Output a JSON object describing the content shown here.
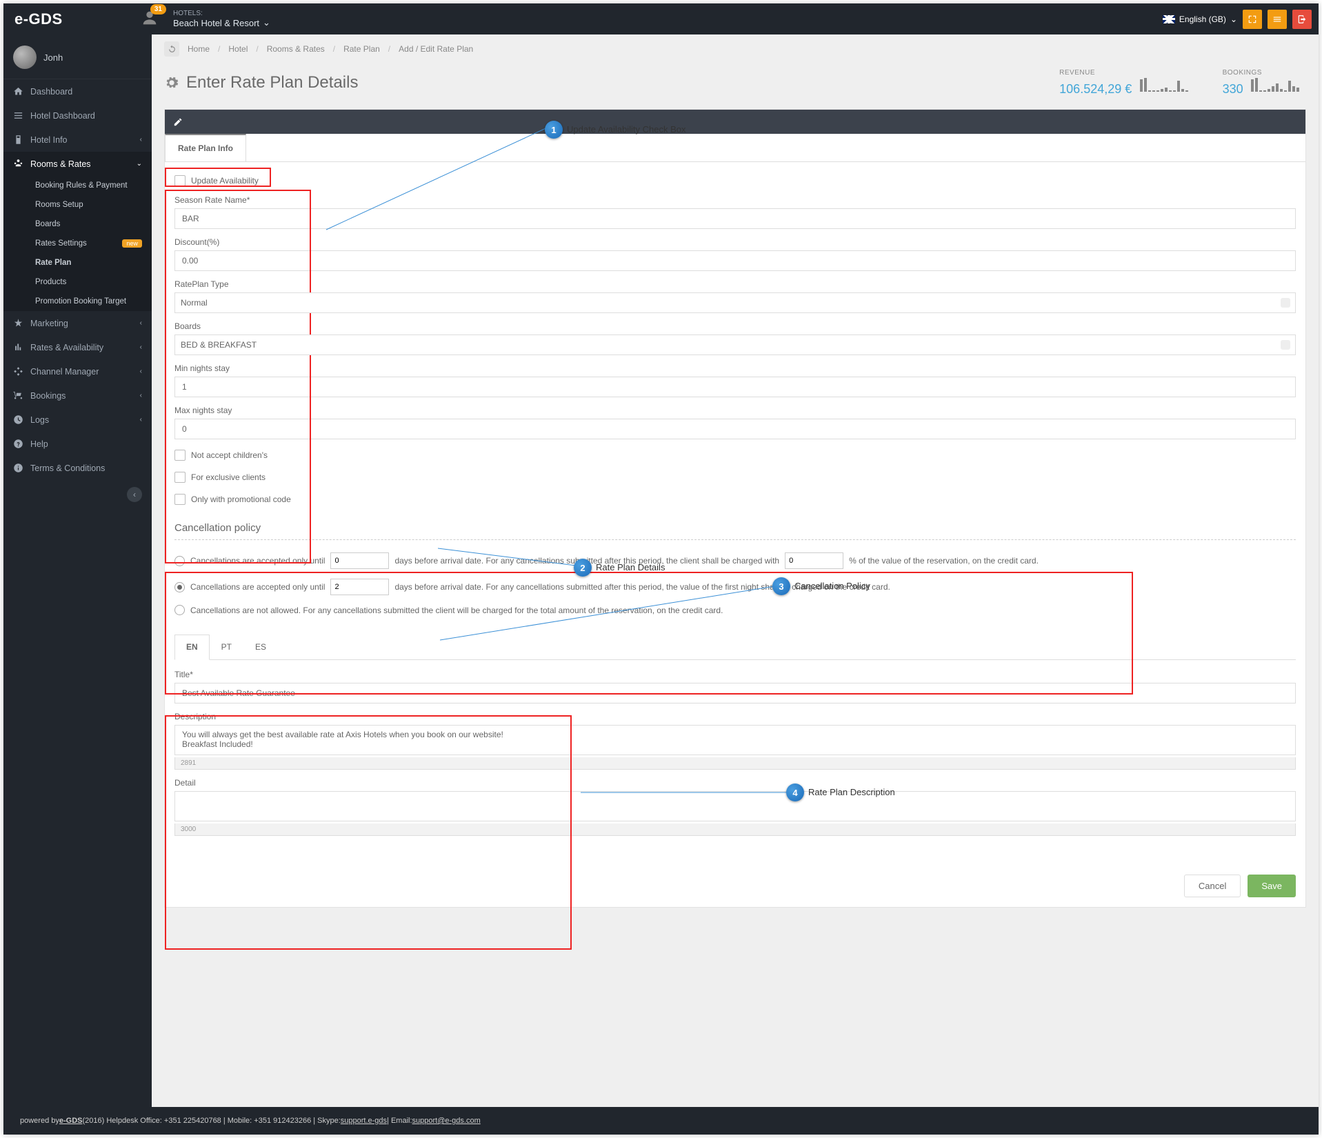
{
  "brand": "e-GDS",
  "top": {
    "badge_count": "31",
    "hotels_label": "HOTELS:",
    "hotel_name": "Beach Hotel & Resort",
    "lang": "English (GB)"
  },
  "user": "Jonh",
  "menu": {
    "dashboard": "Dashboard",
    "hotel_dashboard": "Hotel Dashboard",
    "hotel_info": "Hotel Info",
    "rooms_rates": "Rooms & Rates",
    "sub": {
      "booking_rules": "Booking Rules & Payment",
      "rooms_setup": "Rooms Setup",
      "boards": "Boards",
      "rates_settings": "Rates Settings",
      "new_badge": "new",
      "rate_plan": "Rate Plan",
      "products": "Products",
      "promotion": "Promotion Booking Target"
    },
    "marketing": "Marketing",
    "rates_avail": "Rates & Availability",
    "channel_manager": "Channel Manager",
    "bookings": "Bookings",
    "logs": "Logs",
    "help": "Help",
    "terms": "Terms & Conditions"
  },
  "crumbs": [
    "Home",
    "Hotel",
    "Rooms & Rates",
    "Rate Plan",
    "Add / Edit Rate Plan"
  ],
  "page_title": "Enter Rate Plan Details",
  "stats": {
    "rev_label": "REVENUE",
    "rev_value": "106.524,29 €",
    "book_label": "BOOKINGS",
    "book_value": "330"
  },
  "tab_info": "Rate Plan Info",
  "form": {
    "update_avail": "Update Availability",
    "season_label": "Season Rate Name*",
    "season_value": "BAR",
    "discount_label": "Discount(%)",
    "discount_value": "0.00",
    "type_label": "RatePlan Type",
    "type_value": "Normal",
    "boards_label": "Boards",
    "boards_value": "BED & BREAKFAST",
    "min_label": "Min nights stay",
    "min_value": "1",
    "max_label": "Max nights stay",
    "max_value": "0",
    "no_children": "Not accept children's",
    "exclusive": "For exclusive clients",
    "promo_only": "Only with promotional code"
  },
  "cancel": {
    "header": "Cancellation policy",
    "r1a": "Cancellations are accepted only until",
    "r1b": "days before arrival date. For any cancellations submitted after this period, the client shall be charged with",
    "r1c": "% of the value of the reservation, on the credit card.",
    "r1_days": "0",
    "r1_pct": "0",
    "r2a": "Cancellations are accepted only until",
    "r2b": "days before arrival date. For any cancellations submitted after this period, the value of the first night shall be charged on the credit card.",
    "r2_days": "2",
    "r3": "Cancellations are not allowed. For any cancellations submitted the client will be charged for the total amount of the reservation, on the credit card."
  },
  "lang_tabs": {
    "en": "EN",
    "pt": "PT",
    "es": "ES"
  },
  "desc": {
    "title_label": "Title*",
    "title_value": "Best Available Rate Guarantee",
    "desc_label": "Description",
    "desc_value": "You will always get the best available rate at Axis Hotels when you book on our website!\nBreakfast Included!",
    "desc_count": "2891",
    "detail_label": "Detail",
    "detail_value": "",
    "detail_count": "3000"
  },
  "buttons": {
    "cancel": "Cancel",
    "save": "Save"
  },
  "markers": {
    "m1": "Update Availability Check Box",
    "m2": "Rate Plan Details",
    "m3": "Cancellation Policy",
    "m4": "Rate Plan Description"
  },
  "footer": {
    "p1": "powered by ",
    "egds": "e-GDS",
    "p2": " (2016) Helpdesk Office: +351 225420768 | Mobile: +351 912423266 | Skype: ",
    "skype": "support.e-gds",
    "p3": " | Email: ",
    "email": "support@e-gds.com"
  }
}
